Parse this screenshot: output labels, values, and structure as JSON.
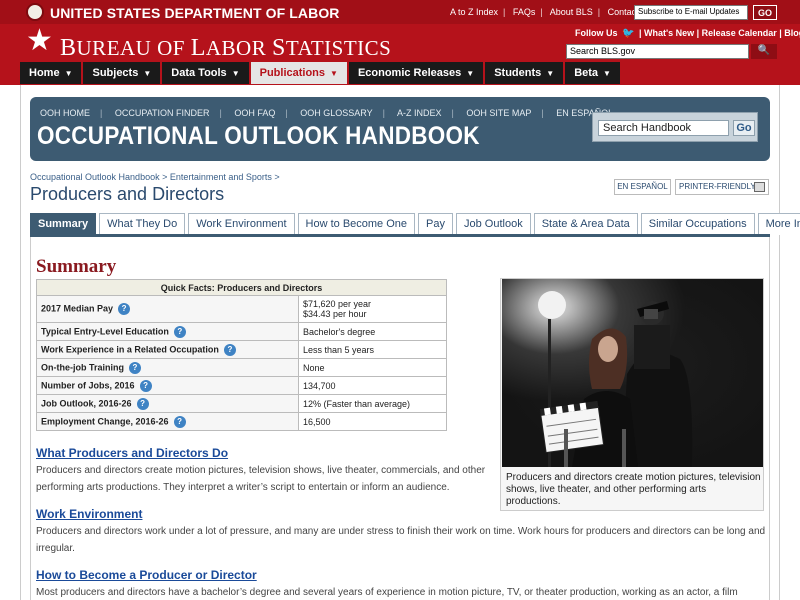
{
  "header": {
    "dol_title": "UNITED STATES DEPARTMENT OF LABOR",
    "top_links": [
      "A to Z Index",
      "FAQs",
      "About BLS",
      "Contact Us"
    ],
    "email_placeholder": "Subscribe to E-mail Updates",
    "go_label": "GO",
    "bls_title_first": "B",
    "bls_title_rest1": "UREAU OF ",
    "bls_title_L": "L",
    "bls_title_rest2": "ABOR ",
    "bls_title_S": "S",
    "bls_title_rest3": "TATISTICS",
    "follow_us": "Follow Us",
    "follow_links": "| What's New | Release Calendar | Blog",
    "search_placeholder": "Search BLS.gov"
  },
  "nav": {
    "items": [
      "Home",
      "Subjects",
      "Data Tools",
      "Publications",
      "Economic Releases",
      "Students",
      "Beta"
    ],
    "active": "Publications"
  },
  "ooh": {
    "links": [
      "OOH HOME",
      "OCCUPATION FINDER",
      "OOH FAQ",
      "OOH GLOSSARY",
      "A-Z INDEX",
      "OOH SITE MAP",
      "EN ESPAÑOL"
    ],
    "title": "OCCUPATIONAL OUTLOOK HANDBOOK",
    "search_value": "Search Handbook",
    "search_button": "Go"
  },
  "breadcrumb": [
    "Occupational Outlook Handbook",
    "Entertainment and Sports"
  ],
  "page_title": "Producers and Directors",
  "utility": {
    "espanol": "EN ESPAÑOL",
    "printer": "PRINTER-FRIENDLY"
  },
  "tabs": [
    "Summary",
    "What They Do",
    "Work Environment",
    "How to Become One",
    "Pay",
    "Job Outlook",
    "State & Area Data",
    "Similar Occupations",
    "More Info"
  ],
  "summary": {
    "heading": "Summary",
    "quick_facts_title": "Quick Facts: Producers and Directors",
    "rows": [
      {
        "label": "2017 Median Pay",
        "value": "$71,620 per year",
        "value2": "$34.43 per hour"
      },
      {
        "label": "Typical Entry-Level Education",
        "value": "Bachelor's degree"
      },
      {
        "label": "Work Experience in a Related Occupation",
        "value": "Less than 5 years"
      },
      {
        "label": "On-the-job Training",
        "value": "None"
      },
      {
        "label": "Number of Jobs, 2016",
        "value": "134,700"
      },
      {
        "label": "Job Outlook, 2016-26",
        "value": "12% (Faster than average)"
      },
      {
        "label": "Employment Change, 2016-26",
        "value": "16,500"
      }
    ],
    "help_icon": "?"
  },
  "photo_caption": "Producers and directors create motion pictures, television shows, live theater, and other performing arts productions.",
  "sections": [
    {
      "heading": "What Producers and Directors Do",
      "text": "Producers and directors create motion pictures, television shows, live theater, commercials, and other performing arts productions. They interpret a writer’s script to entertain or inform an audience."
    },
    {
      "heading": "Work Environment",
      "text": "Producers and directors work under a lot of pressure, and many are under stress to finish their work on time.  Work hours for producers and directors can be long and irregular."
    },
    {
      "heading": "How to Become a Producer or Director",
      "text": "Most producers and directors have a bachelor’s degree and several years of experience in motion picture, TV, or theater production, working as an actor, a film"
    }
  ],
  "colors": {
    "header_red": "#b5121b",
    "ooh_blue": "#3d5b72",
    "link_blue": "#1a4a99",
    "summary_red": "#8a1a20"
  },
  "icons": [
    "dol-seal-icon",
    "bls-star-icon",
    "twitter-icon",
    "search-icon",
    "help-icon",
    "printer-icon",
    "caret-down-icon"
  ]
}
